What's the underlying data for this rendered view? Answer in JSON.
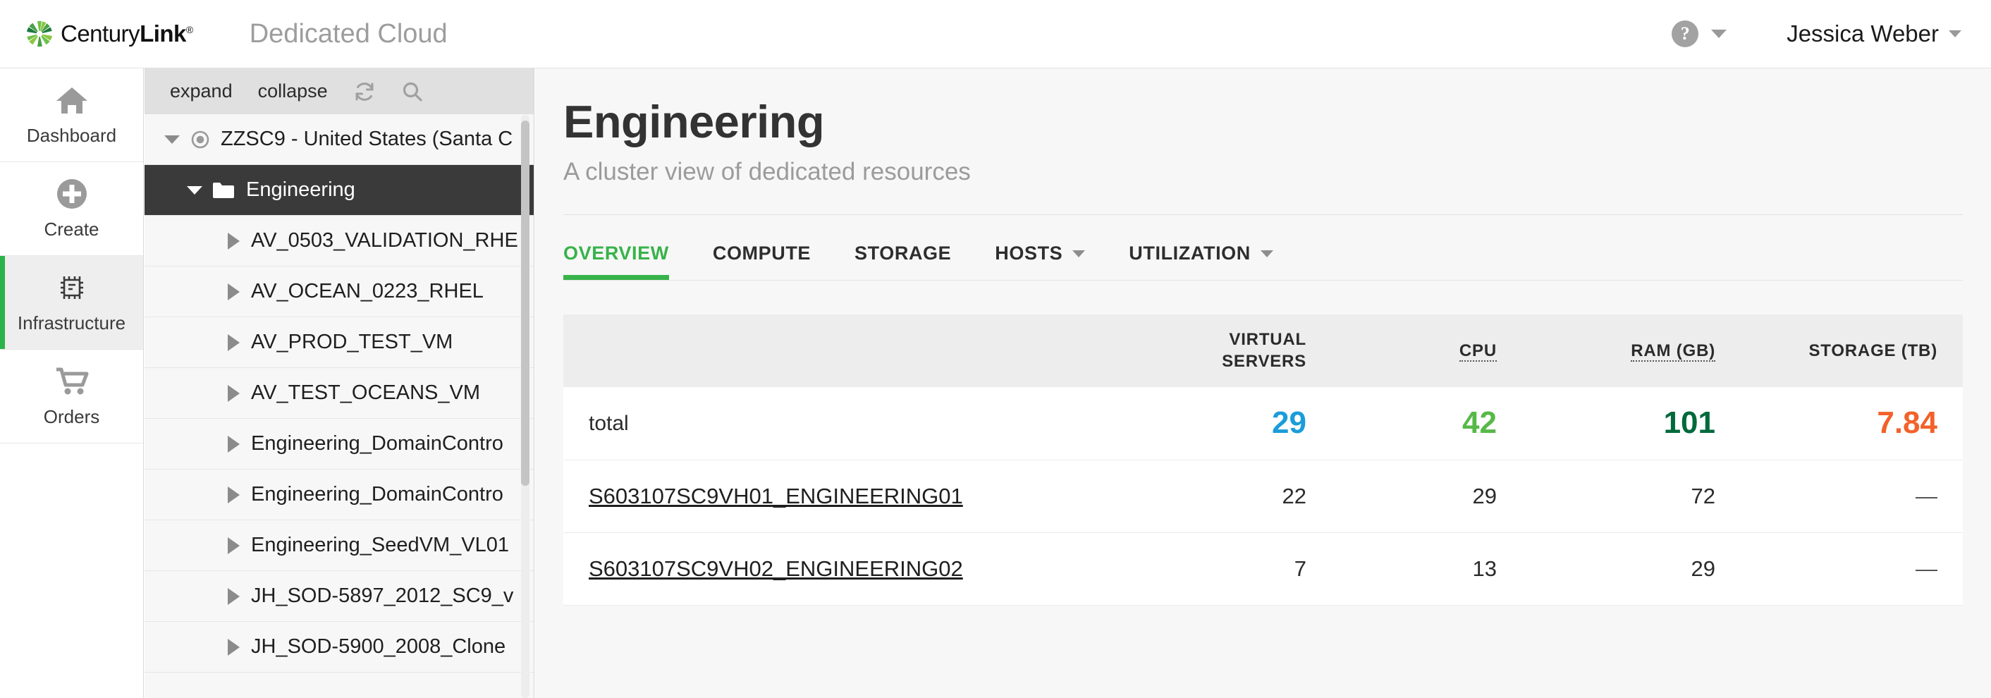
{
  "header": {
    "brand_name_light": "Century",
    "brand_name_bold": "Link",
    "brand_reg": "®",
    "app_title": "Dedicated Cloud",
    "help_glyph": "?",
    "user_name": "Jessica Weber"
  },
  "rail": {
    "items": [
      {
        "label": "Dashboard",
        "icon": "home-icon",
        "active": false
      },
      {
        "label": "Create",
        "icon": "plus-circle-icon",
        "active": false
      },
      {
        "label": "Infrastructure",
        "icon": "chip-icon",
        "active": true
      },
      {
        "label": "Orders",
        "icon": "cart-icon",
        "active": false
      }
    ],
    "active_accent": "#2cb34a"
  },
  "tree": {
    "toolbar": {
      "expand_label": "expand",
      "collapse_label": "collapse",
      "refresh_icon": "refresh-icon",
      "search_icon": "search-icon"
    },
    "rows": [
      {
        "label": "ZZSC9 - United States (Santa C",
        "level": 0,
        "twisty": "down",
        "icon": "datacenter-icon",
        "selected": false
      },
      {
        "label": "Engineering",
        "level": 1,
        "twisty": "down",
        "icon": "folder-icon",
        "selected": true
      },
      {
        "label": "AV_0503_VALIDATION_RHE",
        "level": 2,
        "twisty": "right",
        "icon": "none",
        "selected": false
      },
      {
        "label": "AV_OCEAN_0223_RHEL",
        "level": 2,
        "twisty": "right",
        "icon": "none",
        "selected": false
      },
      {
        "label": "AV_PROD_TEST_VM",
        "level": 2,
        "twisty": "right",
        "icon": "none",
        "selected": false
      },
      {
        "label": "AV_TEST_OCEANS_VM",
        "level": 2,
        "twisty": "right",
        "icon": "none",
        "selected": false
      },
      {
        "label": "Engineering_DomainContro",
        "level": 2,
        "twisty": "right",
        "icon": "none",
        "selected": false
      },
      {
        "label": "Engineering_DomainContro",
        "level": 2,
        "twisty": "right",
        "icon": "none",
        "selected": false
      },
      {
        "label": "Engineering_SeedVM_VL01",
        "level": 2,
        "twisty": "right",
        "icon": "none",
        "selected": false
      },
      {
        "label": "JH_SOD-5897_2012_SC9_v",
        "level": 2,
        "twisty": "right",
        "icon": "none",
        "selected": false
      },
      {
        "label": "JH_SOD-5900_2008_Clone",
        "level": 2,
        "twisty": "right",
        "icon": "none",
        "selected": false
      }
    ]
  },
  "main": {
    "title": "Engineering",
    "subtitle": "A cluster view of dedicated resources",
    "tabs": [
      {
        "label": "OVERVIEW",
        "active": true,
        "caret": false
      },
      {
        "label": "COMPUTE",
        "active": false,
        "caret": false
      },
      {
        "label": "STORAGE",
        "active": false,
        "caret": false
      },
      {
        "label": "HOSTS",
        "active": false,
        "caret": true
      },
      {
        "label": "UTILIZATION",
        "active": false,
        "caret": true
      }
    ],
    "table": {
      "columns": [
        {
          "key": "name",
          "label": "",
          "abbr": false
        },
        {
          "key": "virtual_servers",
          "label": "VIRTUAL SERVERS",
          "line1": "VIRTUAL",
          "line2": "SERVERS",
          "abbr": false
        },
        {
          "key": "cpu",
          "label": "CPU",
          "abbr": true
        },
        {
          "key": "ram",
          "label": "RAM (GB)",
          "abbr": true
        },
        {
          "key": "storage",
          "label": "STORAGE (TB)",
          "abbr": false
        }
      ],
      "total_row": {
        "label": "total",
        "virtual_servers": "29",
        "cpu": "42",
        "ram": "101",
        "storage": "7.84",
        "colors": {
          "virtual_servers": "#1b9dd9",
          "cpu": "#57b947",
          "ram": "#00693c",
          "storage": "#f2622a"
        }
      },
      "rows": [
        {
          "name": "S603107SC9VH01_ENGINEERING01",
          "virtual_servers": "22",
          "cpu": "29",
          "ram": "72",
          "storage": "—"
        },
        {
          "name": "S603107SC9VH02_ENGINEERING02",
          "virtual_servers": "7",
          "cpu": "13",
          "ram": "29",
          "storage": "—"
        }
      ]
    }
  }
}
